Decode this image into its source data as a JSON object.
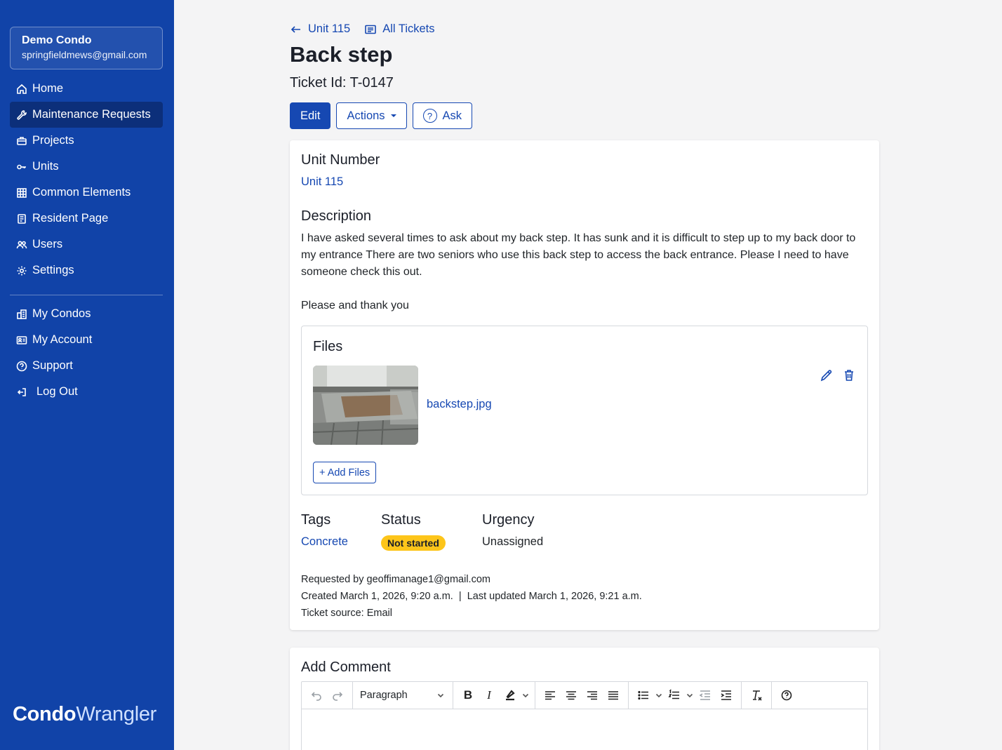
{
  "sidebar": {
    "org_name": "Demo Condo",
    "org_email": "springfieldmews@gmail.com",
    "nav": [
      {
        "label": "Home",
        "icon": "home-icon"
      },
      {
        "label": "Maintenance Requests",
        "icon": "wrench-icon",
        "active": true
      },
      {
        "label": "Projects",
        "icon": "briefcase-icon"
      },
      {
        "label": "Units",
        "icon": "key-icon"
      },
      {
        "label": "Common Elements",
        "icon": "building-grid-icon"
      },
      {
        "label": "Resident Page",
        "icon": "document-icon"
      },
      {
        "label": "Users",
        "icon": "users-icon"
      },
      {
        "label": "Settings",
        "icon": "gear-icon"
      }
    ],
    "nav2": [
      {
        "label": "My Condos",
        "icon": "buildings-icon"
      },
      {
        "label": "My Account",
        "icon": "id-card-icon"
      },
      {
        "label": "Support",
        "icon": "question-circle-icon"
      },
      {
        "label": "Log Out",
        "icon": "logout-icon"
      }
    ],
    "brand_bold": "Condo",
    "brand_light": "Wrangler"
  },
  "breadcrumb": {
    "unit": "Unit 115",
    "all_tickets": "All Tickets"
  },
  "ticket": {
    "title": "Back step",
    "id_label": "Ticket Id: T-0147"
  },
  "buttons": {
    "edit": "Edit",
    "actions": "Actions",
    "ask": "Ask"
  },
  "details": {
    "unit_number_label": "Unit Number",
    "unit_number_value": "Unit 115",
    "description_label": "Description",
    "description_p1": "I have asked several times to ask about my back step. It has sunk and it is difficult to step up to my back door to my entrance  There are two seniors who use this back step to access the back entrance. Please I need to have someone check this out.",
    "description_p2": "Please and thank you",
    "files_label": "Files",
    "file_name": "backstep.jpg",
    "add_files": "+ Add Files",
    "tags_label": "Tags",
    "tags_value": "Concrete",
    "status_label": "Status",
    "status_value": "Not started",
    "urgency_label": "Urgency",
    "urgency_value": "Unassigned",
    "requested_by": "Requested by geoffimanage1@gmail.com",
    "created": "Created March 1, 2026, 9:20 a.m.  |  Last updated March 1, 2026, 9:21 a.m.",
    "source": "Ticket source: Email"
  },
  "comment": {
    "title": "Add Comment",
    "format_select": "Paragraph"
  },
  "colors": {
    "sidebar_bg": "#1143a8",
    "accent": "#1648b2",
    "status_badge": "#fdc51a"
  }
}
